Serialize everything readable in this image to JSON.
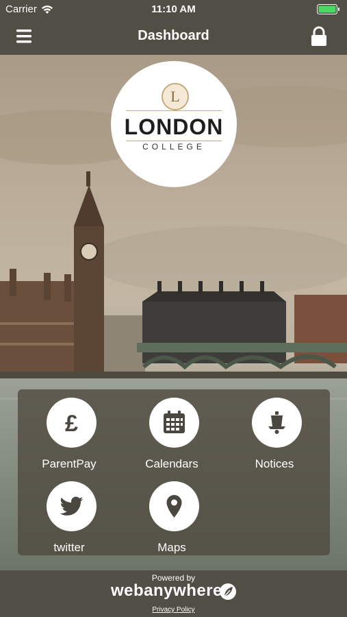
{
  "status_bar": {
    "carrier": "Carrier",
    "time": "11:10 AM",
    "battery_color": "#4cd964"
  },
  "nav": {
    "title": "Dashboard",
    "menu_icon": "hamburger-icon",
    "lock_icon": "lock-icon"
  },
  "logo": {
    "initial": "L",
    "name": "LONDON",
    "sub": "COLLEGE"
  },
  "tiles": [
    {
      "label": "ParentPay",
      "icon": "pound-icon"
    },
    {
      "label": "Calendars",
      "icon": "calendar-icon"
    },
    {
      "label": "Notices",
      "icon": "bell-icon"
    },
    {
      "label": "twitter",
      "icon": "twitter-icon"
    },
    {
      "label": "Maps",
      "icon": "map-pin-icon"
    }
  ],
  "footer": {
    "powered_by": "Powered by",
    "brand": "webanywhere",
    "privacy": "Privacy Policy"
  },
  "colors": {
    "bar": "#514e46",
    "panel": "#4e483e",
    "tile_icon": "#4a4740"
  }
}
